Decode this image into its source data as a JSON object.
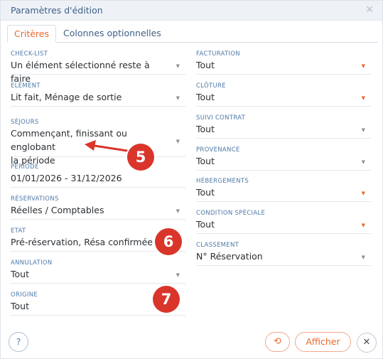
{
  "window": {
    "title": "Paramètres d'édition"
  },
  "tabs": [
    {
      "label": "Critères"
    },
    {
      "label": "Colonnes optionnelles"
    }
  ],
  "left_fields": {
    "checklist": {
      "label": "CHECK-LIST",
      "value": "Un élément sélectionné reste à faire"
    },
    "element": {
      "label": "ELÉMENT",
      "value": "Lit fait, Ménage de sortie"
    },
    "sejours": {
      "label": "SÉJOURS",
      "value_line1": "Commençant, finissant ou englobant",
      "value_line2": "la période"
    },
    "periode": {
      "label": "PÉRIODE",
      "value": "01/01/2026 - 31/12/2026"
    },
    "reservations": {
      "label": "RÉSERVATIONS",
      "value": "Réelles / Comptables"
    },
    "etat": {
      "label": "ETAT",
      "value": "Pré-réservation, Résa confirmée"
    },
    "annulation": {
      "label": "ANNULATION",
      "value": "Tout"
    },
    "origine": {
      "label": "ORIGINE",
      "value": "Tout"
    }
  },
  "right_fields": {
    "facturation": {
      "label": "FACTURATION",
      "value": "Tout"
    },
    "cloture": {
      "label": "CLÔTURE",
      "value": "Tout"
    },
    "suivi_contrat": {
      "label": "SUIVI CONTRAT",
      "value": "Tout"
    },
    "provenance": {
      "label": "PROVENANCE",
      "value": "Tout"
    },
    "hebergements": {
      "label": "HÉBERGEMENTS",
      "value": "Tout"
    },
    "condition_speciale": {
      "label": "CONDITION SPÉCIALE",
      "value": "Tout"
    },
    "classement": {
      "label": "CLASSEMENT",
      "value": "N° Réservation"
    }
  },
  "annotations": {
    "step5": "5",
    "step6": "6",
    "step7": "7"
  },
  "footer": {
    "help": "?",
    "apply": "Afficher"
  },
  "colors": {
    "accent": "#e8692f",
    "label_blue": "#4d79a8",
    "badge_red": "#d9352b"
  }
}
